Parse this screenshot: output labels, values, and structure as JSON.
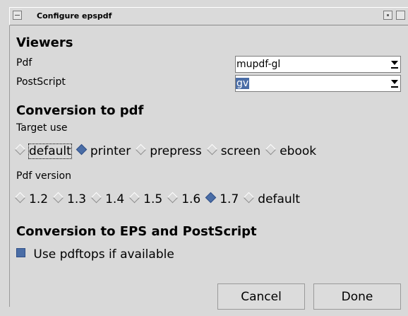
{
  "window": {
    "title": "Configure epspdf"
  },
  "viewers": {
    "heading": "Viewers",
    "pdf_label": "Pdf",
    "pdf_value": "mupdf-gl",
    "ps_label": "PostScript",
    "ps_value": "gv"
  },
  "conversion_pdf": {
    "heading": "Conversion to pdf",
    "target_label": "Target use",
    "target_options": [
      "default",
      "printer",
      "prepress",
      "screen",
      "ebook"
    ],
    "target_selected": "printer",
    "version_label": "Pdf version",
    "version_options": [
      "1.2",
      "1.3",
      "1.4",
      "1.5",
      "1.6",
      "1.7",
      "default"
    ],
    "version_selected": "1.7"
  },
  "conversion_eps": {
    "heading": "Conversion to EPS and PostScript",
    "pdftops_label": "Use pdftops if available",
    "pdftops_checked": true
  },
  "buttons": {
    "cancel": "Cancel",
    "done": "Done"
  },
  "colors": {
    "selection": "#4a6da6",
    "background": "#d9d9d9"
  }
}
